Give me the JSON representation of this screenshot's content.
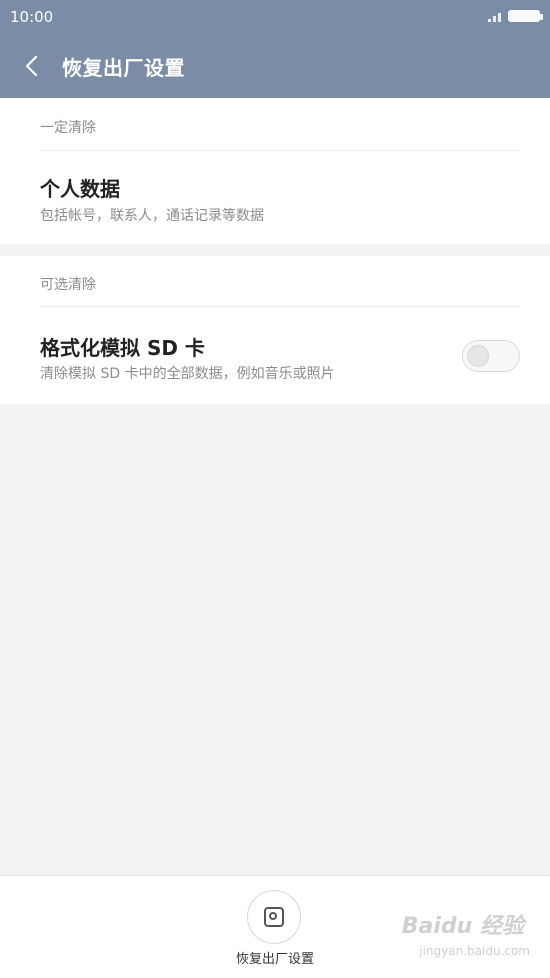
{
  "status_bar": {
    "time": "10:00"
  },
  "title_bar": {
    "title": "恢复出厂设置"
  },
  "section_required": {
    "header": "一定清除",
    "item": {
      "title": "个人数据",
      "subtitle": "包括帐号，联系人，通话记录等数据"
    }
  },
  "section_optional": {
    "header": "可选清除",
    "item": {
      "title": "格式化模拟 SD 卡",
      "subtitle": "清除模拟 SD 卡中的全部数据，例如音乐或照片",
      "toggle_on": false
    }
  },
  "bottom_action": {
    "label": "恢复出厂设置"
  },
  "watermark": {
    "text": "Baidu 经验",
    "sub": "jingyan.baidu.com"
  },
  "colors": {
    "header_bg": "#7b8da6",
    "page_bg": "#f2f2f2",
    "card_bg": "#ffffff"
  }
}
